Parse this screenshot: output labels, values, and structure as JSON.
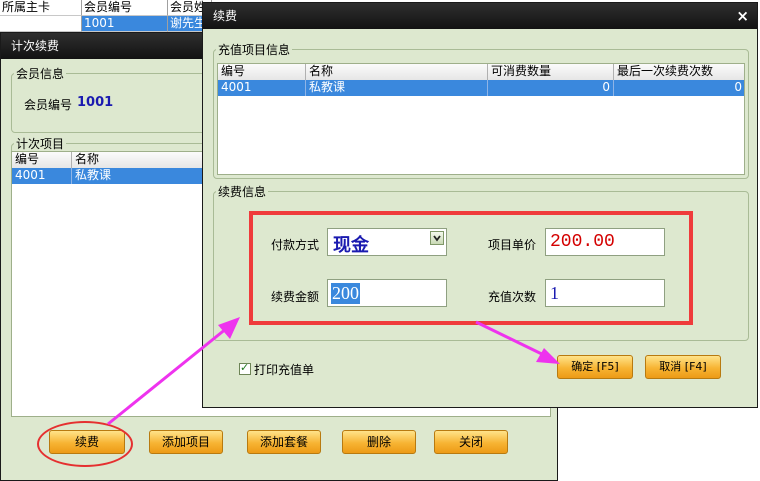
{
  "background_grid": {
    "headers": [
      "所属主卡",
      "会员编号",
      "会员姓"
    ],
    "row": [
      "",
      "1001",
      "谢先生"
    ]
  },
  "left_window": {
    "title": "计次续费",
    "member_group": {
      "legend": "会员信息",
      "label": "会员编号",
      "value": "1001"
    },
    "items_group": {
      "legend": "计次项目",
      "headers": [
        "编号",
        "名称"
      ],
      "rows": [
        [
          "4001",
          "私教课"
        ]
      ]
    },
    "buttons": {
      "renew": "续费",
      "add_item": "添加项目",
      "add_package": "添加套餐",
      "delete": "删除",
      "close": "关闭"
    }
  },
  "dialog": {
    "title": "续费",
    "close_glyph": "×",
    "recharge_group": {
      "legend": "充值项目信息",
      "headers": [
        "编号",
        "名称",
        "可消费数量",
        "最后一次续费次数"
      ],
      "rows": [
        [
          "4001",
          "私教课",
          "0",
          "0"
        ]
      ]
    },
    "renew_group": {
      "legend": "续费信息",
      "payment_label": "付款方式",
      "payment_value": "现金",
      "unit_price_label": "项目单价",
      "unit_price_value": "200.00",
      "amount_label": "续费金额",
      "amount_value": "200",
      "count_label": "充值次数",
      "count_value": "1"
    },
    "print_checkbox": {
      "label": "打印充值单",
      "checked": true,
      "check_glyph": "✓"
    },
    "buttons": {
      "ok": "确定 [F5]",
      "cancel": "取消 [F4]"
    }
  },
  "colors": {
    "accent_selection": "#3a88dd",
    "annotation_red": "#ef3b3b",
    "annotation_arrow": "#ee33ee",
    "price_red": "#d40000",
    "value_blue": "#1a1ab0"
  }
}
